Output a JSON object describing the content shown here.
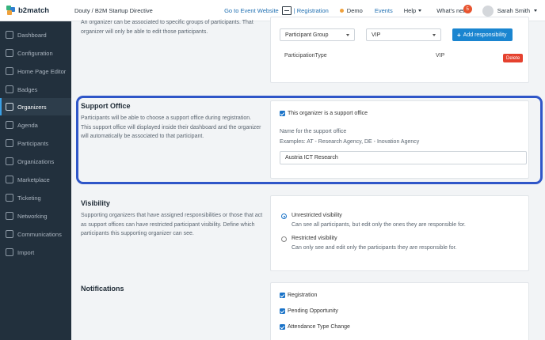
{
  "header": {
    "brand": "b2match",
    "event_title": "Douty / B2M Startup Directive",
    "go_to_event": "Go to Event Website",
    "registration": "| Registration",
    "demo": "Demo",
    "events": "Events",
    "help": "Help",
    "whats_new": "What's new",
    "whats_new_count": "5",
    "user_name": "Sarah Smith"
  },
  "sidebar": {
    "items": [
      {
        "label": "Dashboard",
        "icon": "dashboard-icon"
      },
      {
        "label": "Configuration",
        "icon": "configuration-icon"
      },
      {
        "label": "Home Page Editor",
        "icon": "home-page-editor-icon"
      },
      {
        "label": "Badges",
        "icon": "badges-icon"
      },
      {
        "label": "Organizers",
        "icon": "organizers-icon",
        "active": true
      },
      {
        "label": "Agenda",
        "icon": "agenda-icon"
      },
      {
        "label": "Participants",
        "icon": "participants-icon"
      },
      {
        "label": "Organizations",
        "icon": "organizations-icon"
      },
      {
        "label": "Marketplace",
        "icon": "marketplace-icon"
      },
      {
        "label": "Ticketing",
        "icon": "ticketing-icon"
      },
      {
        "label": "Networking",
        "icon": "networking-icon"
      },
      {
        "label": "Communications",
        "icon": "communications-icon"
      },
      {
        "label": "Import",
        "icon": "import-icon"
      }
    ]
  },
  "responsibilities": {
    "desc": "An organizer can be associated to specific groups of participants. That organizer will only be able to edit those participants.",
    "type_select": "Participant Group",
    "value_select": "VIP",
    "add_button": "Add responsibility",
    "row_type": "ParticipationType",
    "row_value": "VIP",
    "delete_button": "Delete"
  },
  "support_office": {
    "title": "Support Office",
    "desc": "Participants will be able to choose a support office during registration. This support office will displayed inside their dashboard and the organizer will automatically be associated to that participant.",
    "checkbox_label": "This organizer is a support office",
    "name_label": "Name for the support office",
    "examples": "Examples: AT - Research Agency, DE - Inovation Agency",
    "name_value": "Austria ICT Research"
  },
  "visibility": {
    "title": "Visibility",
    "desc": "Supporting organizers that have assigned responsibilities or those that act as support offices can have restricted participant visibility. Define which participants this supporting organizer can see.",
    "option1_label": "Unrestricted visibility",
    "option1_desc": "Can see all participants, but edit only the ones they are responsible for.",
    "option2_label": "Restricted visibility",
    "option2_desc": "Can only see and edit only the participants they are responsible for."
  },
  "notifications": {
    "title": "Notifications",
    "items": [
      "Registration",
      "Pending Opportunity",
      "Attendance Type Change"
    ]
  },
  "colors": {
    "sidebar_bg": "#22303d",
    "accent": "#1a85d0",
    "highlight": "#2f56c8",
    "danger": "#e5412e"
  }
}
